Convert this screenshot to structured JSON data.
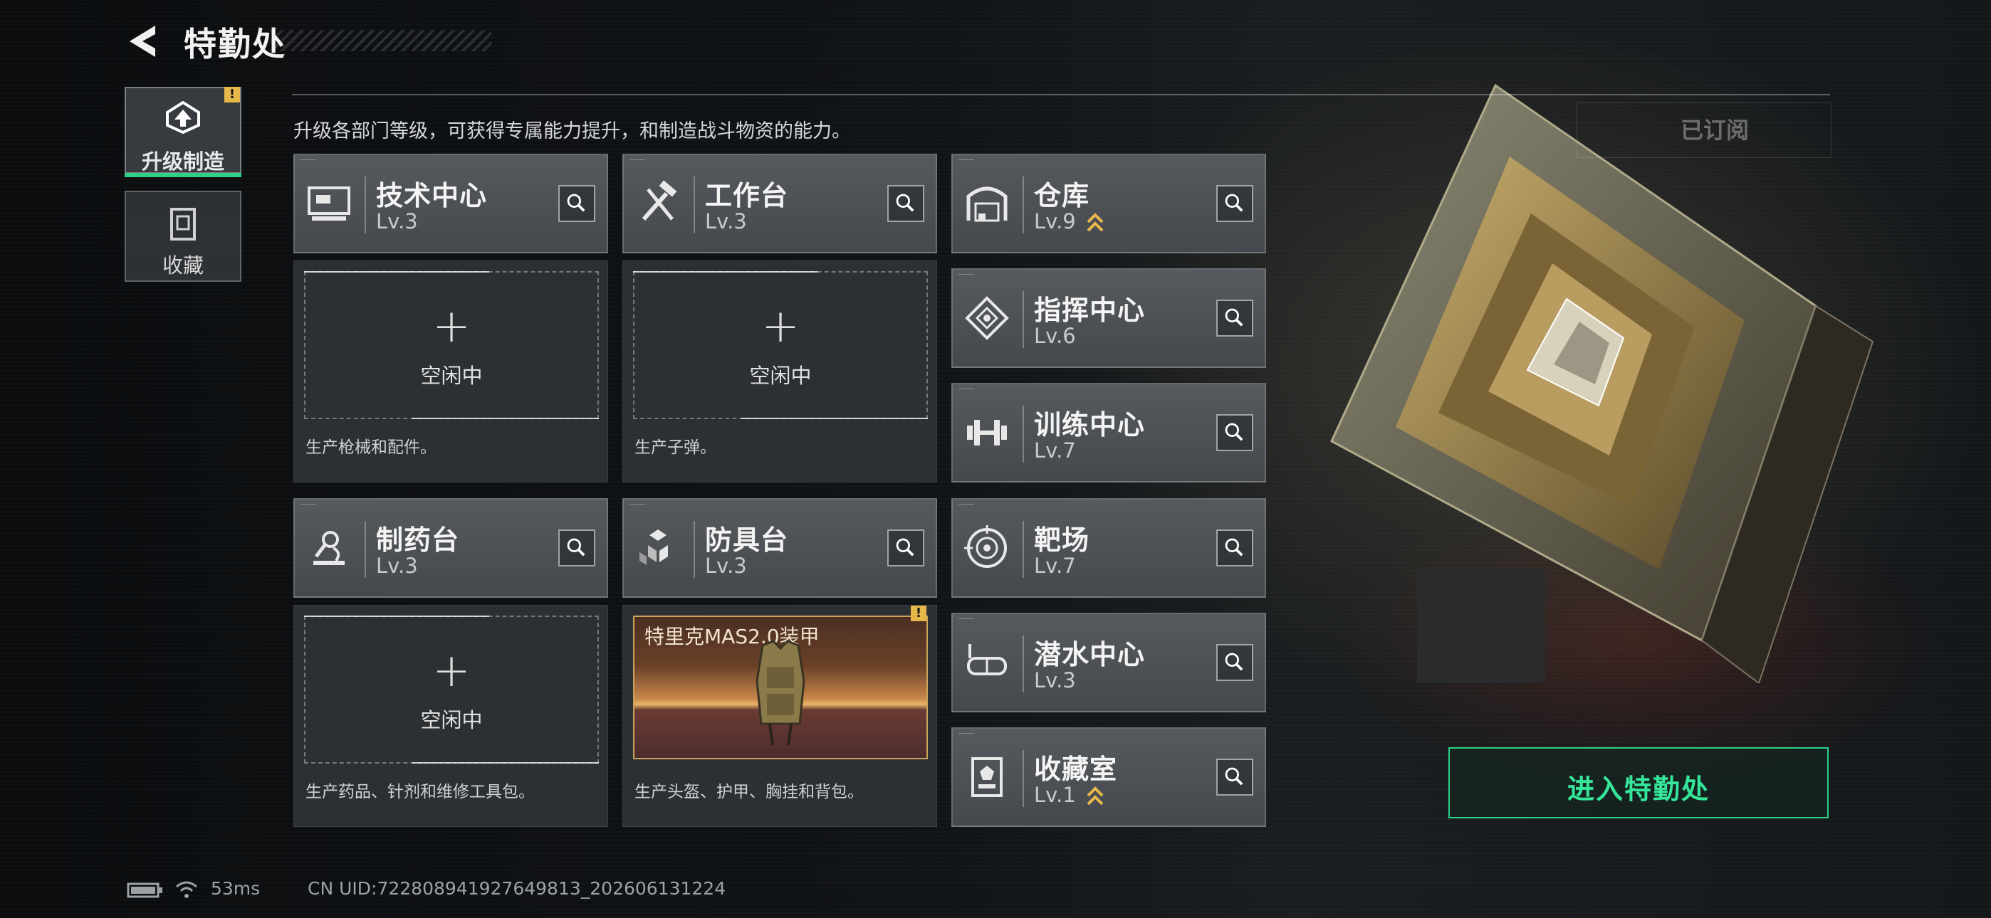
{
  "header": {
    "title": "特勤处",
    "description": "升级各部门等级，可获得专属能力提升，和制造战斗物资的能力。",
    "subscribed_label": "已订阅"
  },
  "side_tabs": [
    {
      "label": "升级制造",
      "icon": "upgrade-icon",
      "active": true,
      "alert": "!"
    },
    {
      "label": "收藏",
      "icon": "collection-icon",
      "active": false
    }
  ],
  "departments": [
    {
      "name": "技术中心",
      "level": "Lv.3",
      "icon": "tech-center-icon",
      "upgradable": false
    },
    {
      "name": "工作台",
      "level": "Lv.3",
      "icon": "workbench-icon",
      "upgradable": false
    },
    {
      "name": "仓库",
      "level": "Lv.9",
      "icon": "warehouse-icon",
      "upgradable": true
    },
    {
      "name": "指挥中心",
      "level": "Lv.6",
      "icon": "command-center-icon",
      "upgradable": false
    },
    {
      "name": "训练中心",
      "level": "Lv.7",
      "icon": "training-center-icon",
      "upgradable": false
    },
    {
      "name": "制药台",
      "level": "Lv.3",
      "icon": "pharmacy-icon",
      "upgradable": false
    },
    {
      "name": "防具台",
      "level": "Lv.3",
      "icon": "armor-bench-icon",
      "upgradable": false
    },
    {
      "name": "靶场",
      "level": "Lv.7",
      "icon": "shooting-range-icon",
      "upgradable": false
    },
    {
      "name": "潜水中心",
      "level": "Lv.3",
      "icon": "diving-center-icon",
      "upgradable": false
    },
    {
      "name": "收藏室",
      "level": "Lv.1",
      "icon": "collection-room-icon",
      "upgradable": true
    }
  ],
  "slots": [
    {
      "state": "空闲中",
      "description": "生产枪械和配件。"
    },
    {
      "state": "空闲中",
      "description": "生产子弹。"
    },
    {
      "state": "空闲中",
      "description": "生产药品、针剂和维修工具包。"
    },
    {
      "item": "特里克MAS2.0装甲",
      "description": "生产头盔、护甲、胸挂和背包。",
      "alert": "!"
    }
  ],
  "enter_button": "进入特勤处",
  "status": {
    "ping": "53ms",
    "uid": "CN UID:722808941927649813_202606131224"
  },
  "colors": {
    "accent": "#2fd08a",
    "warning": "#e6b84a",
    "armor_frame": "#c9a45a"
  }
}
